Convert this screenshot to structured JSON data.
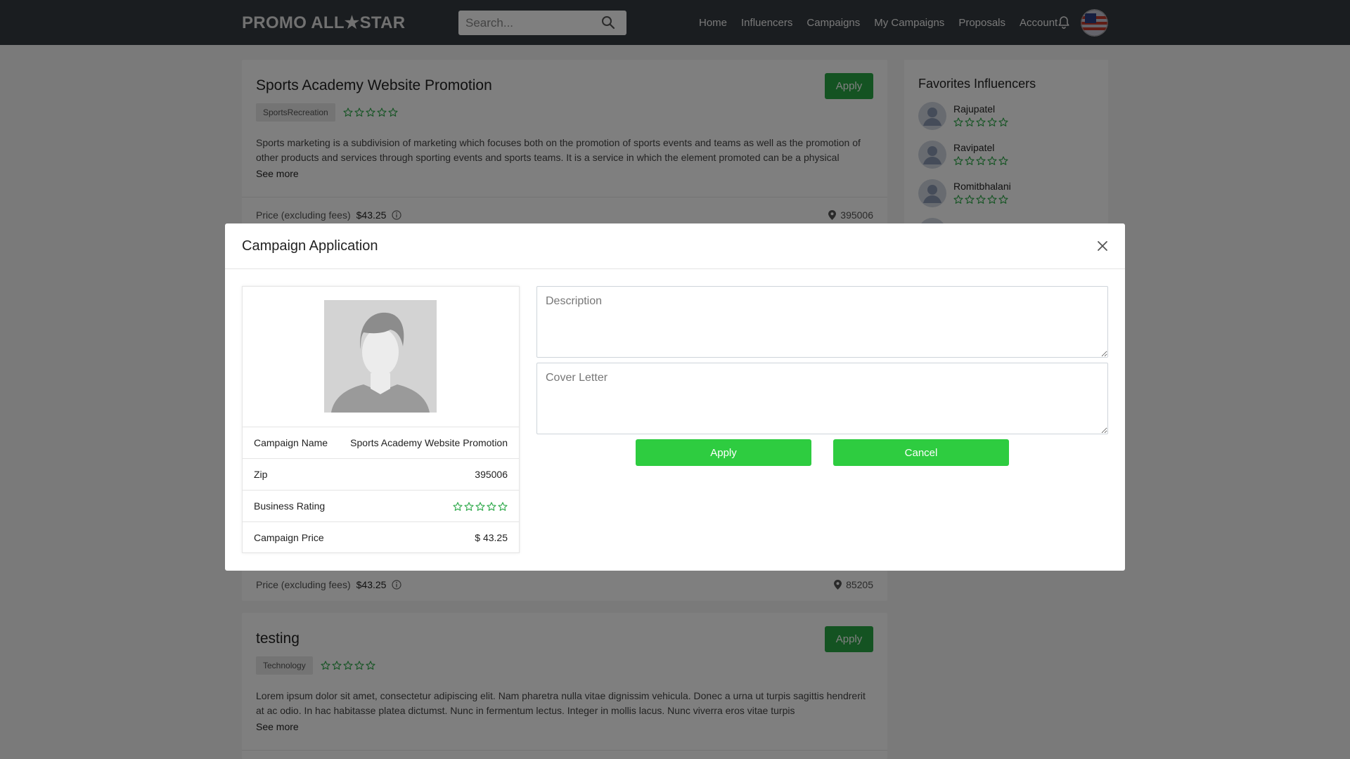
{
  "nav": {
    "logo": "PROMO ALL★STAR",
    "search_placeholder": "Search...",
    "links": [
      "Home",
      "Influencers",
      "Campaigns",
      "My Campaigns",
      "Proposals",
      "Account"
    ],
    "icons": [
      "search-icon",
      "bell-icon",
      "avatar"
    ]
  },
  "campaigns": [
    {
      "title": "Sports Academy Website Promotion",
      "apply_label": "Apply",
      "tag": "SportsRecreation",
      "rating": 0,
      "description": "Sports marketing is a subdivision of marketing which focuses both on the promotion of sports events and teams as well as the promotion of other products and services through sporting events and sports teams. It is a service in which the element promoted can be a physical",
      "see_more": "See more",
      "price_label": "Price (excluding fees)",
      "price": "$43.25",
      "zip": "395006"
    },
    {
      "price_label": "Price (excluding fees)",
      "price": "$43.25",
      "zip": "85205"
    },
    {
      "title": "testing",
      "apply_label": "Apply",
      "tag": "Technology",
      "rating": 0,
      "description": "Lorem ipsum dolor sit amet, consectetur adipiscing elit. Nam pharetra nulla vitae dignissim vehicula. Donec a urna ut turpis sagittis hendrerit at ac odio. In hac habitasse platea dictumst. Nunc in fermentum lectus. Integer in mollis lacus. Nunc viverra eros vitae turpis",
      "see_more": "See more"
    }
  ],
  "favorites": {
    "title": "Favorites Influencers",
    "items": [
      {
        "name": "Rajupatel",
        "rating": 0
      },
      {
        "name": "Ravipatel",
        "rating": 0
      },
      {
        "name": "Romitbhalani",
        "rating": 0
      }
    ]
  },
  "modal": {
    "title": "Campaign Application",
    "details": [
      {
        "label": "Campaign Name",
        "value": "Sports Academy Website Promotion"
      },
      {
        "label": "Zip",
        "value": "395006"
      },
      {
        "label": "Business Rating",
        "rating": 0
      },
      {
        "label": "Campaign Price",
        "value": "$ 43.25"
      }
    ],
    "description_placeholder": "Description",
    "cover_letter_placeholder": "Cover Letter",
    "apply_label": "Apply",
    "cancel_label": "Cancel"
  },
  "colors": {
    "navbar": "#343a40",
    "apply_green": "#28a745",
    "modal_button_green": "#2ecc40",
    "star_green": "#28a745"
  }
}
